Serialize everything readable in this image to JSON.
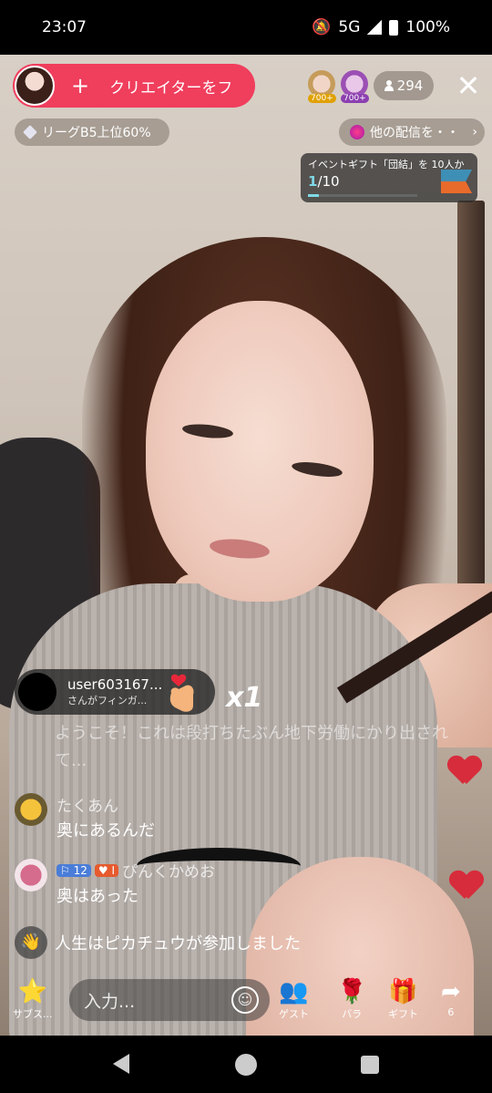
{
  "status": {
    "time": "23:07",
    "network": "5G",
    "battery": "100%"
  },
  "top": {
    "creator_plus": "+",
    "creator_text": "クリエイターをフ",
    "viewer_badges": [
      "700+",
      "700+"
    ],
    "viewer_count": "294",
    "close": "✕",
    "league": "リーグB5上位60%",
    "other_streams": "他の配信を・・",
    "other_chevron": "›"
  },
  "event": {
    "title": "イベントギフト「団結」を 10人か",
    "current": "1",
    "total": "/10",
    "progress": 0.1
  },
  "gift": {
    "user": "user603167...",
    "subtitle": "さんがフィンガ...",
    "count": "x1"
  },
  "chat": {
    "faded": "ようこそ！これは段打ちたぶん地下労働にかり出されて...",
    "messages": [
      {
        "name": "たくあん",
        "text": "奥にあるんだ"
      },
      {
        "name": "ぴんくかめお",
        "level": "12",
        "fan": "I",
        "text": "奥はあった"
      }
    ],
    "join": "人生はピカチュウが参加しました"
  },
  "bottom": {
    "subscribe_label": "サブス...",
    "input_placeholder": "入力...",
    "guest_label": "ゲスト",
    "rose_label": "バラ",
    "gift_label": "ギフト",
    "share_count": "6"
  },
  "colors": {
    "accent": "#f03e5d",
    "progress": "#7fd9e6",
    "heart": "#d72c3b"
  }
}
